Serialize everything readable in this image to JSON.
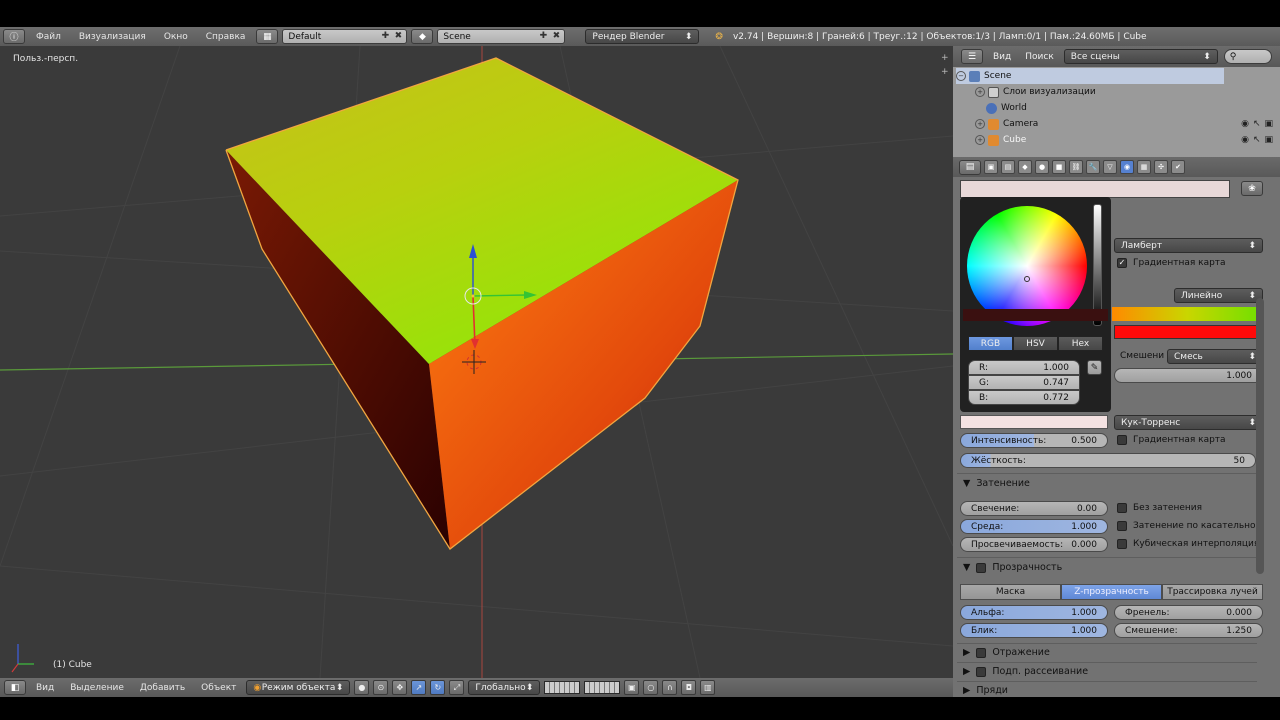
{
  "topbar": {
    "menus": [
      "Файл",
      "Визуализация",
      "Окно",
      "Справка"
    ],
    "layout_value": "Default",
    "scene_value": "Scene",
    "engine_value": "Рендер Blender",
    "stats": "v2.74 | Вершин:8 | Граней:6 | Треуг.:12 | Объектов:1/3 | Ламп:0/1 | Пам.:24.60МБ | Cube"
  },
  "viewport": {
    "view_name": "Польз.-персп.",
    "object_label": "(1) Cube"
  },
  "vp_header": {
    "menus": [
      "Вид",
      "Выделение",
      "Добавить",
      "Объект"
    ],
    "mode_value": "Режим объекта",
    "orientation_value": "Глобально"
  },
  "outliner": {
    "menus": [
      "Вид",
      "Поиск"
    ],
    "filter_value": "Все сцены",
    "rows": [
      {
        "label": "Scene"
      },
      {
        "label": "Слои визуализации"
      },
      {
        "label": "World"
      },
      {
        "label": "Camera"
      },
      {
        "label": "Cube"
      }
    ]
  },
  "picker": {
    "tabs": [
      "RGB",
      "HSV",
      "Hex"
    ],
    "r_label": "R:",
    "r_value": "1.000",
    "g_label": "G:",
    "g_value": "0.747",
    "b_label": "B:",
    "b_value": "0.772"
  },
  "props": {
    "diffuse_shader": "Ламберт",
    "gradient_map_label": "Градиентная карта",
    "ramp_interp": "Линейно",
    "blend_label": "Смешени",
    "blend_value": "Смесь",
    "factor_value": "1.000",
    "specular_shader": "Кук-Торренс",
    "intensity_label": "Интенсивность:",
    "intensity_value": "0.500",
    "spec_gradient_label": "Градиентная карта",
    "hardness_label": "Жёсткость:",
    "hardness_value": "50",
    "shading_title": "Затенение",
    "emit_label": "Свечение:",
    "emit_value": "0.00",
    "ambient_label": "Среда:",
    "ambient_value": "1.000",
    "translucency_label": "Просвечиваемость:",
    "translucency_value": "0.000",
    "shadeless_label": "Без затенения",
    "tangent_label": "Затенение по касательной",
    "cubic_label": "Кубическая интерполяция",
    "transparency_title": "Прозрачность",
    "trans_tabs": [
      "Маска",
      "Z-прозрачность",
      "Трассировка лучей"
    ],
    "alpha_label": "Альфа:",
    "alpha_value": "1.000",
    "fresnel_label": "Френель:",
    "fresnel_value": "0.000",
    "specular_label": "Блик:",
    "specular_value": "1.000",
    "blend2_label": "Смешение:",
    "blend2_value": "1.250",
    "mirror_title": "Отражение",
    "sss_title": "Подп. рассеивание",
    "strand_title": "Пряди"
  }
}
